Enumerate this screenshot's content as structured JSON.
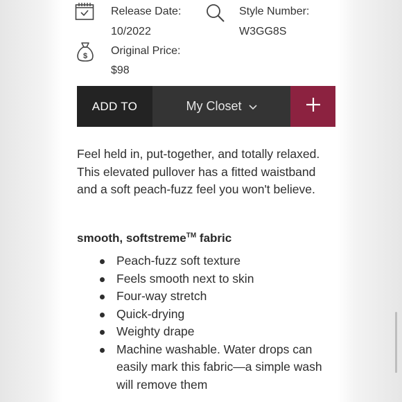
{
  "product": {
    "release_date_label": "Release Date:",
    "release_date_value": "10/2022",
    "style_number_label": "Style Number:",
    "style_number_value": "W3GG8S",
    "original_price_label": "Original Price:",
    "original_price_value": "$98"
  },
  "actions": {
    "add_to_label": "ADD TO",
    "closet_label": "My Closet",
    "closet_chevron": "∨",
    "plus_label": "+",
    "accent_color": "#8c2240"
  },
  "description": "Feel held in, put-together, and totally relaxed. This elevated pullover has a fitted waistband and a soft peach-fuzz feel you won't believe.",
  "fabric": {
    "heading_main": "smooth, softstreme",
    "heading_tm": "TM",
    "heading_end": " fabric",
    "features": [
      "Peach-fuzz soft texture",
      "Feels smooth next to skin",
      "Four-way stretch",
      "Quick-drying",
      "Weighty drape",
      "Machine washable. Water drops can easily mark this fabric—a simple wash will remove them"
    ]
  },
  "icons": {
    "calendar": "calendar-icon",
    "search": "search-icon",
    "money_bag": "money-bag-icon"
  }
}
